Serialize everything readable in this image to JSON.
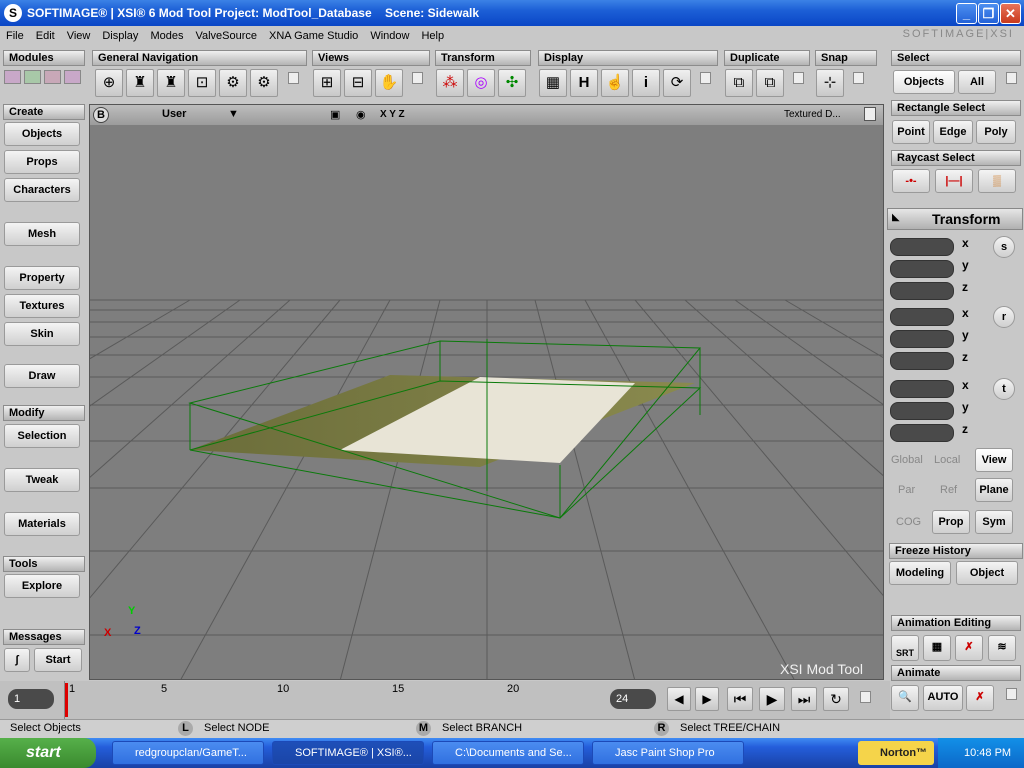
{
  "window": {
    "title": "SOFTIMAGE® | XSI® 6 Mod Tool Project: ModTool_Database    Scene: Sidewalk",
    "brand": "SOFTIMAGE|XSI"
  },
  "menu": [
    "File",
    "Edit",
    "View",
    "Display",
    "Modes",
    "ValveSource",
    "XNA Game Studio",
    "Window",
    "Help"
  ],
  "toolbar_sections": {
    "modules": "Modules",
    "general_navigation": "General Navigation",
    "views": "Views",
    "transform": "Transform",
    "display": "Display",
    "duplicate": "Duplicate",
    "snap": "Snap",
    "select": "Select"
  },
  "display_h": "H",
  "display_i": "i",
  "select": {
    "objects": "Objects",
    "all": "All",
    "rect_select": "Rectangle Select",
    "point": "Point",
    "edge": "Edge",
    "poly": "Poly",
    "raycast": "Raycast Select"
  },
  "left": {
    "create": "Create",
    "objects": "Objects",
    "props": "Props",
    "characters": "Characters",
    "mesh": "Mesh",
    "property": "Property",
    "textures": "Textures",
    "skin": "Skin",
    "draw": "Draw",
    "modify": "Modify",
    "selection": "Selection",
    "tweak": "Tweak",
    "materials": "Materials",
    "tools": "Tools",
    "explore": "Explore",
    "messages": "Messages",
    "start": "Start"
  },
  "viewport": {
    "b": "B",
    "camera": "User",
    "axes": "X Y Z",
    "mode": "Textured D...",
    "watermark": "XSI Mod Tool",
    "axis_x": "X",
    "axis_y": "Y",
    "axis_z": "Z"
  },
  "transform": {
    "title": "Transform",
    "x": "x",
    "y": "y",
    "z": "z",
    "s": "s",
    "r": "r",
    "t": "t",
    "global": "Global",
    "local": "Local",
    "view": "View",
    "par": "Par",
    "ref": "Ref",
    "plane": "Plane",
    "cog": "COG",
    "prop": "Prop",
    "sym": "Sym"
  },
  "freeze": {
    "title": "Freeze History",
    "modeling": "Modeling",
    "object": "Object"
  },
  "anim": {
    "title": "Animation Editing",
    "srt": "SRT",
    "animate": "Animate",
    "auto": "AUTO"
  },
  "timeline": {
    "current": "1",
    "ticks": [
      "1",
      "5",
      "10",
      "15",
      "20"
    ],
    "end": "24"
  },
  "status": {
    "left": "Select Objects",
    "l_key": "L",
    "l_text": "Select NODE",
    "m_key": "M",
    "m_text": "Select BRANCH",
    "r_key": "R",
    "r_text": "Select TREE/CHAIN"
  },
  "taskbar": {
    "start": "start",
    "tasks": [
      "redgroupclan/GameT...",
      "SOFTIMAGE® | XSI®...",
      "C:\\Documents and Se...",
      "Jasc Paint Shop Pro"
    ],
    "norton": "Norton™",
    "clock": "10:48 PM"
  }
}
